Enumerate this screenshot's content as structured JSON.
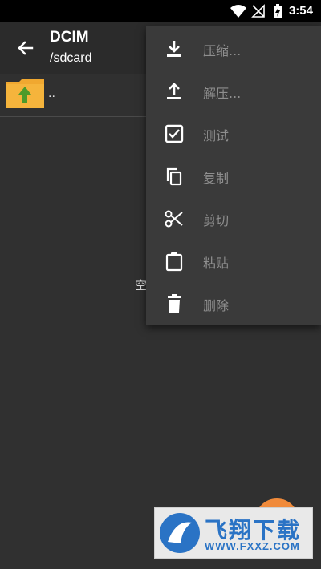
{
  "status_bar": {
    "time": "3:54",
    "icons": [
      "wifi-icon",
      "signal-muted-icon",
      "battery-charging-icon"
    ]
  },
  "toolbar": {
    "title": "DCIM",
    "subtitle": "/sdcard",
    "back_icon": "arrow-left-icon"
  },
  "file_list": {
    "items": [
      {
        "name": "..",
        "icon": "folder-up-icon"
      }
    ],
    "empty_text": "空"
  },
  "context_menu": {
    "items": [
      {
        "label": "压缩...",
        "icon": "download-icon"
      },
      {
        "label": "解压...",
        "icon": "upload-icon"
      },
      {
        "label": "测试",
        "icon": "checkbox-icon"
      },
      {
        "label": "复制",
        "icon": "copy-icon"
      },
      {
        "label": "剪切",
        "icon": "scissors-icon"
      },
      {
        "label": "粘贴",
        "icon": "clipboard-icon"
      },
      {
        "label": "删除",
        "icon": "trash-icon"
      }
    ]
  },
  "watermark": {
    "text": "飞翔下载",
    "subtext": "WWW.FXXZ.COM"
  },
  "colors": {
    "background": "#303030",
    "menu_bg": "#3a3a3a",
    "menu_label": "#8f8f8f",
    "folder": "#f0a830",
    "fab": "#f08a3a"
  }
}
